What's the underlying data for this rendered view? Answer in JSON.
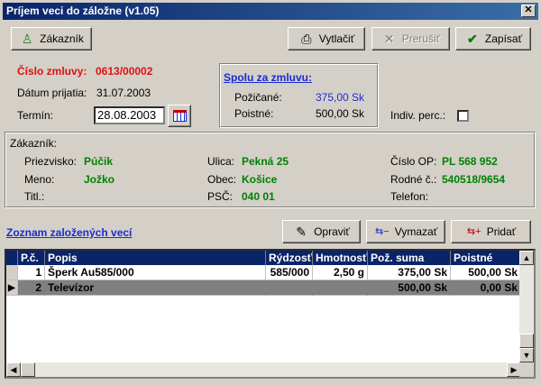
{
  "window": {
    "title": "Príjem veci do záložne (v1.05)"
  },
  "toolbar": {
    "customer_label": "Zákazník",
    "print_label": "Vytlačiť",
    "abort_label": "Prerušiť",
    "write_label": "Zapísať"
  },
  "contract": {
    "number_label": "Číslo zmluvy:",
    "number_value": "0613/00002",
    "date_label": "Dátum prijatia:",
    "date_value": "31.07.2003",
    "term_label": "Termín:",
    "term_value": "28.08.2003"
  },
  "summary": {
    "title": "Spolu za zmluvu:",
    "borrowed_label": "Požičané:",
    "borrowed_value": "375,00 Sk",
    "fee_label": "Poistné:",
    "fee_value": "500,00 Sk",
    "indiv_label": "Indiv. perc.:"
  },
  "customer": {
    "section_label": "Zákazník:",
    "surname_label": "Priezvisko:",
    "surname_value": "Púčik",
    "name_label": "Meno:",
    "name_value": "Jožko",
    "title_label": "Titl.:",
    "title_value": "",
    "street_label": "Ulica:",
    "street_value": "Pekná 25",
    "city_label": "Obec:",
    "city_value": "Košice",
    "zip_label": "PSČ:",
    "zip_value": "040 01",
    "id_label": "Číslo OP:",
    "id_value": "PL 568 952",
    "birth_label": "Rodné č.:",
    "birth_value": "540518/9654",
    "phone_label": "Telefon:",
    "phone_value": ""
  },
  "items": {
    "link_label": "Zoznam založených vecí",
    "edit_label": "Opraviť",
    "delete_label": "Vymazať",
    "add_label": "Pridať",
    "columns": [
      "P.č.",
      "Popis",
      "Rýdzosť",
      "Hmotnosť",
      "Pož. suma",
      "Poistné"
    ],
    "rows": [
      {
        "no": "1",
        "desc": "Šperk Au585/000",
        "purity": "585/000",
        "weight": "2,50 g",
        "amount": "375,00 Sk",
        "fee": "500,00 Sk"
      },
      {
        "no": "2",
        "desc": "Televízor",
        "purity": "",
        "weight": "",
        "amount": "500,00 Sk",
        "fee": "0,00 Sk"
      }
    ]
  },
  "icons": {
    "customer": "person-icon",
    "print": "printer-icon",
    "abort": "x-icon",
    "write": "checkmark-icon",
    "calendar": "calendar-icon",
    "edit": "edit-icon",
    "delete": "delete-arrows-icon",
    "add": "add-arrows-icon"
  }
}
